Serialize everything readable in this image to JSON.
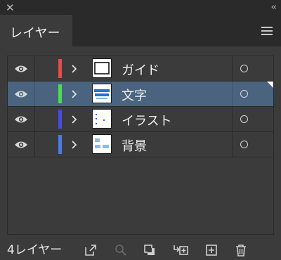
{
  "window": {
    "close_glyph": "✕",
    "collapse_glyph": "‹‹"
  },
  "tab": {
    "label": "レイヤー"
  },
  "layers": [
    {
      "name": "ガイド",
      "color": "#e84a4a",
      "selected": false,
      "thumb": "guide"
    },
    {
      "name": "文字",
      "color": "#4ddc4d",
      "selected": true,
      "thumb": "text"
    },
    {
      "name": "イラスト",
      "color": "#4a4ae8",
      "selected": false,
      "thumb": "illust"
    },
    {
      "name": "背景",
      "color": "#4a7ae8",
      "selected": false,
      "thumb": "bg"
    }
  ],
  "footer": {
    "layer_count": "4レイヤー",
    "icons": [
      "export-icon",
      "search-icon",
      "clipping-mask-icon",
      "new-sublayer-icon",
      "new-layer-icon",
      "trash-icon"
    ]
  }
}
